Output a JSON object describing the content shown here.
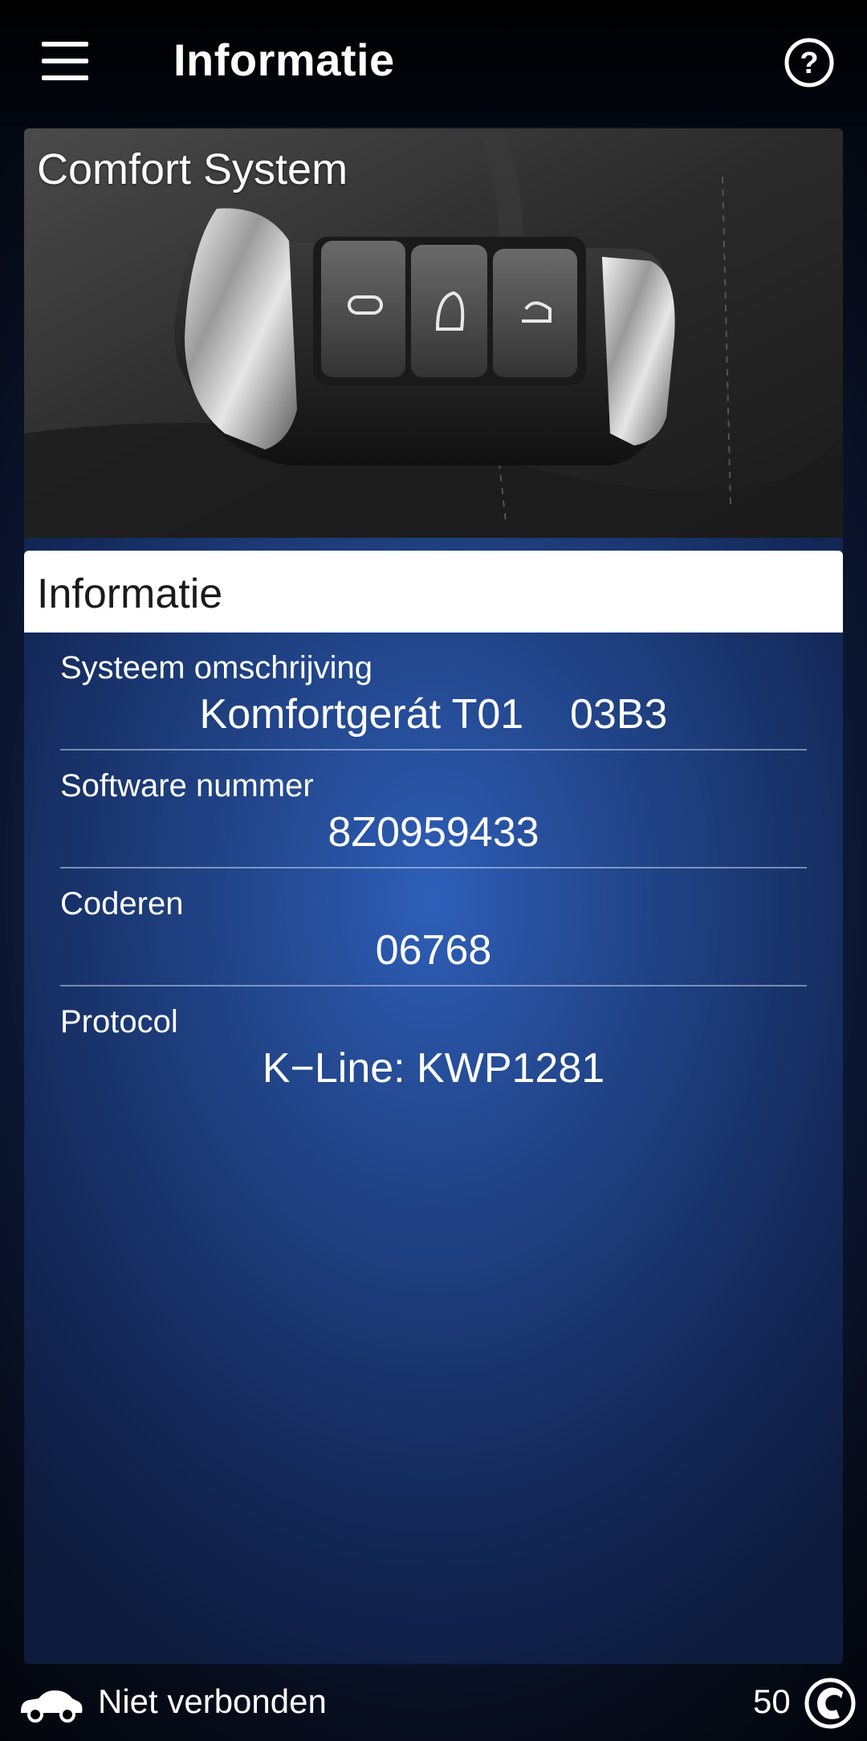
{
  "app_bar": {
    "title": "Informatie",
    "menu_icon": "hamburger-menu-icon",
    "help_icon": "help-circle-icon",
    "help_glyph": "?"
  },
  "hero": {
    "title": "Comfort System",
    "image": "car-key-fob-photo"
  },
  "section": {
    "title": "Informatie"
  },
  "info_rows": [
    {
      "label": "Systeem omschrijving",
      "value": "Komfortgerát T01    03B3"
    },
    {
      "label": "Software nummer",
      "value": "8Z0959433"
    },
    {
      "label": "Coderen",
      "value": "06768"
    },
    {
      "label": "Protocol",
      "value": "K−Line: KWP1281"
    }
  ],
  "status_bar": {
    "connection_text": "Niet verbonden",
    "count": "50",
    "car_icon": "car-connection-icon",
    "logo_icon": "app-logo-icon"
  },
  "colors": {
    "panel_center": "#2e5fb8",
    "panel_edge": "#0d1b3c",
    "header_bg": "#ffffff",
    "text": "#ffffff"
  }
}
